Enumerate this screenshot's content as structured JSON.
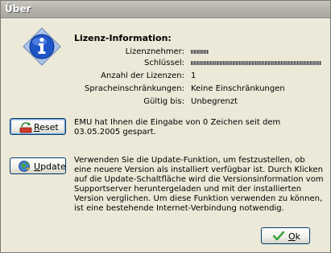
{
  "window": {
    "title": "Über"
  },
  "license": {
    "heading": "Lizenz-Information:",
    "rows": [
      {
        "label": "Lizenznehmer:",
        "value": ""
      },
      {
        "label": "Schlüssel:",
        "value": ""
      },
      {
        "label": "Anzahl der Lizenzen:",
        "value": "1"
      },
      {
        "label": "Spracheinschränkungen:",
        "value": "Keine Einschränkungen"
      },
      {
        "label": "Gültig bis:",
        "value": "Unbegrenzt"
      }
    ]
  },
  "reset": {
    "button_label": "Reset",
    "mnemonic": "R",
    "rest": "eset",
    "text": "EMU hat Ihnen die Eingabe von 0 Zeichen seit dem 03.05.2005 gespart."
  },
  "update": {
    "button_label": "Update",
    "mnemonic": "U",
    "rest": "pdate",
    "text": "Verwenden Sie die Update-Funktion, um festzustellen, ob eine neuere Version als installiert verfügbar ist. Durch Klicken auf die Update-Schaltfläche wird die Versionsinformation vom Supportserver heruntergeladen und mit der installierten Version verglichen. Um diese Funktion verwenden zu können, ist eine bestehende Internet-Verbindung notwendig."
  },
  "ok": {
    "button_label": "Ok",
    "mnemonic": "O",
    "rest": "k"
  },
  "icons": {
    "info": "info-icon",
    "reset": "reset-icon",
    "update": "update-globe-icon",
    "ok": "checkmark-icon"
  },
  "colors": {
    "info_blue": "#1e56c8",
    "ok_green": "#3aa33a"
  }
}
